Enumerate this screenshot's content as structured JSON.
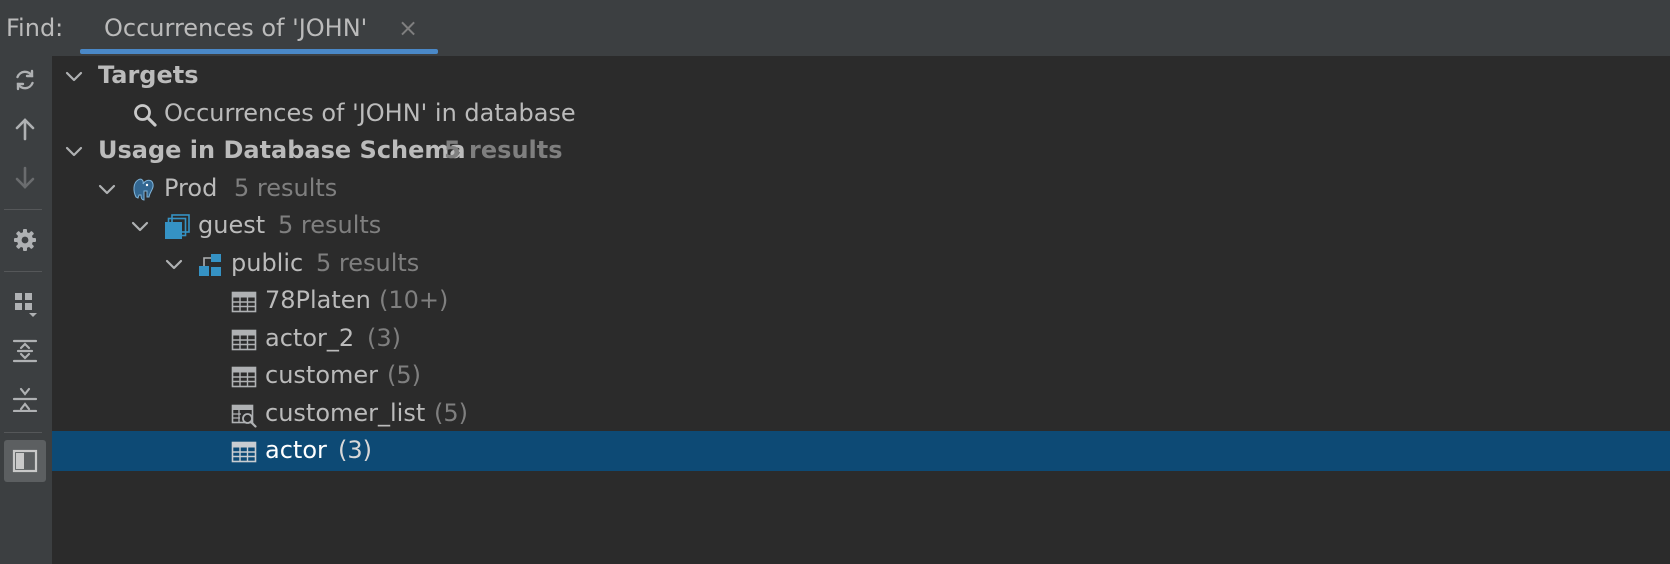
{
  "find_panel": {
    "find_label": "Find:",
    "tab": {
      "title": "Occurrences of 'JOHN'",
      "close_glyph": "×"
    }
  },
  "toolbar": {
    "buttons": [
      {
        "icon": "refresh-icon"
      },
      {
        "icon": "arrow-up-icon"
      },
      {
        "icon": "arrow-down-icon"
      },
      {
        "icon": "gear-icon"
      },
      {
        "icon": "group-by-icon"
      },
      {
        "icon": "expand-all-icon"
      },
      {
        "icon": "collapse-all-icon"
      },
      {
        "icon": "preview-panel-icon"
      }
    ]
  },
  "tree": {
    "targets": {
      "label": "Targets",
      "child": {
        "label": "Occurrences of 'JOHN' in database",
        "icon": "search-icon"
      }
    },
    "usage": {
      "label": "Usage in Database Schema",
      "count": "5 results",
      "datasource": {
        "label": "Prod",
        "count": "5 results",
        "icon": "postgresql-elephant-icon",
        "database": {
          "label": "guest",
          "count": "5 results",
          "icon": "database-icon",
          "schema": {
            "label": "public",
            "count": "5 results",
            "icon": "schema-icon",
            "items": [
              {
                "label": "78Platen",
                "count": "(10+)",
                "icon": "table-icon"
              },
              {
                "label": "actor_2",
                "count": "(3)",
                "icon": "table-icon"
              },
              {
                "label": "customer",
                "count": "(5)",
                "icon": "table-icon"
              },
              {
                "label": "customer_list",
                "count": "(5)",
                "icon": "view-icon"
              },
              {
                "label": "actor",
                "count": "(3)",
                "icon": "table-icon",
                "selected": true
              }
            ]
          }
        }
      }
    }
  },
  "colors": {
    "selection": "#0d4a75",
    "tab_underline": "#4a88c7",
    "background": "#2b2b2b",
    "panel": "#3c3f41"
  }
}
